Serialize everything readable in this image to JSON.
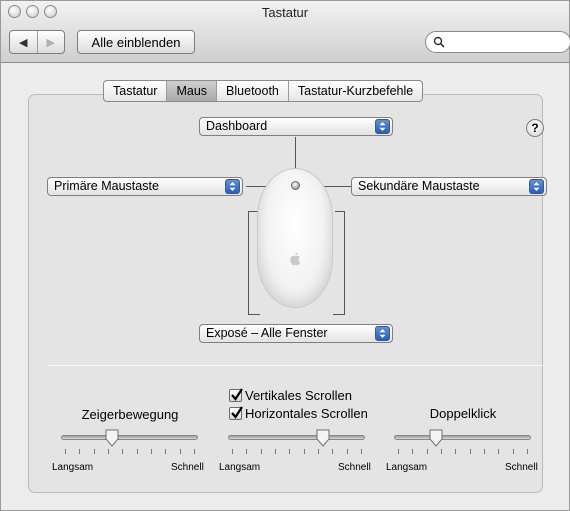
{
  "window": {
    "title": "Tastatur"
  },
  "toolbar": {
    "back_label": "◀",
    "forward_label": "▶",
    "show_all_label": "Alle einblenden",
    "search_value": ""
  },
  "tabs": [
    {
      "label": "Tastatur",
      "active": false
    },
    {
      "label": "Maus",
      "active": true
    },
    {
      "label": "Bluetooth",
      "active": false
    },
    {
      "label": "Tastatur-Kurzbefehle",
      "active": false
    }
  ],
  "mouse": {
    "top_popup": "Dashboard",
    "left_popup": "Primäre Maustaste",
    "right_popup": "Sekundäre Maustaste",
    "bottom_popup": "Exposé – Alle Fenster",
    "help_label": "?"
  },
  "scrolling": {
    "vertical": {
      "label": "Vertikales Scrollen",
      "checked": true
    },
    "horizontal": {
      "label": "Horizontales Scrollen",
      "checked": true
    }
  },
  "sliders": {
    "tracking": {
      "label": "Zeigerbewegung",
      "min_label": "Langsam",
      "max_label": "Schnell",
      "value_fraction": 0.37
    },
    "scroll": {
      "label": "",
      "min_label": "Langsam",
      "max_label": "Schnell",
      "value_fraction": 0.69
    },
    "doubleclick": {
      "label": "Doppelklick",
      "min_label": "Langsam",
      "max_label": "Schnell",
      "value_fraction": 0.31
    }
  },
  "colors": {
    "accent": "#2a5fb8",
    "panel": "#e4e4e4"
  }
}
